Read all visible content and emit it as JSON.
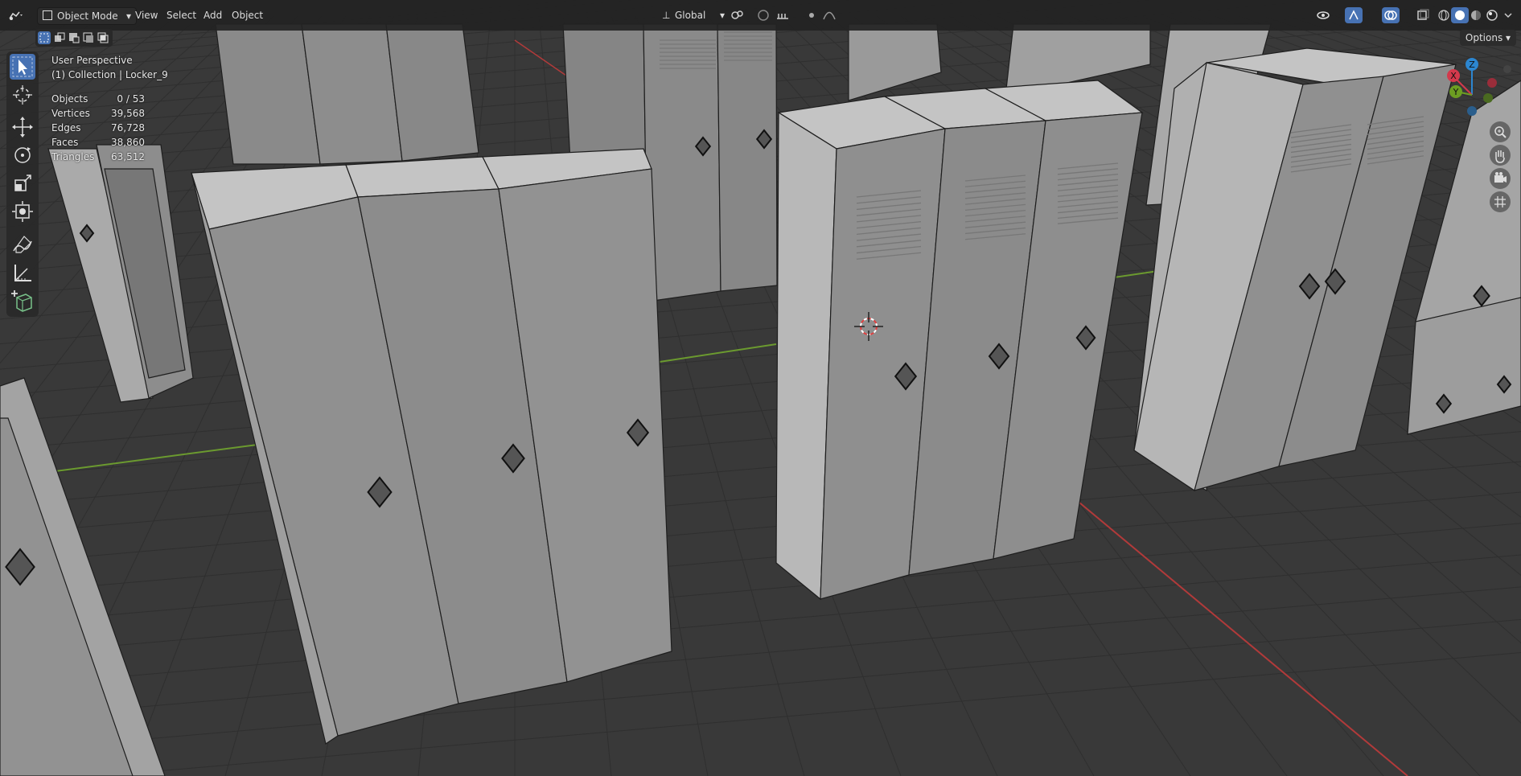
{
  "header": {
    "mode": "Object Mode",
    "menu": [
      "View",
      "Select",
      "Add",
      "Object"
    ],
    "orientation": "Global",
    "options_label": "Options"
  },
  "overlay": {
    "perspective": "User Perspective",
    "collection": "(1) Collection | Locker_9",
    "stats": [
      {
        "label": "Objects",
        "value": "0 / 53"
      },
      {
        "label": "Vertices",
        "value": "39,568"
      },
      {
        "label": "Edges",
        "value": "76,728"
      },
      {
        "label": "Faces",
        "value": "38,860"
      },
      {
        "label": "Triangles",
        "value": "63,512"
      }
    ]
  },
  "gizmo": {
    "x": "X",
    "y": "Y",
    "z": "Z"
  },
  "icons": {
    "editor_type": "3d-viewport-icon",
    "tools": [
      "select-box-icon",
      "cursor-icon",
      "move-icon",
      "rotate-icon",
      "scale-icon",
      "transform-icon",
      "annotate-icon",
      "measure-icon",
      "add-cube-icon"
    ],
    "nav": [
      "zoom-icon",
      "pan-hand-icon",
      "camera-icon",
      "grid-icon"
    ]
  },
  "colors": {
    "accent": "#4772b3",
    "background": "#393939",
    "grid_line": "#2f2f2f",
    "axis_x": "#b13a3a",
    "axis_y": "#6b9a2f",
    "locker_front": "#909090",
    "locker_side": "#b8b8b8",
    "locker_top": "#c4c4c4",
    "gizmo_x": "#d3394c",
    "gizmo_y": "#6c9e22",
    "gizmo_z": "#2c86d0"
  }
}
